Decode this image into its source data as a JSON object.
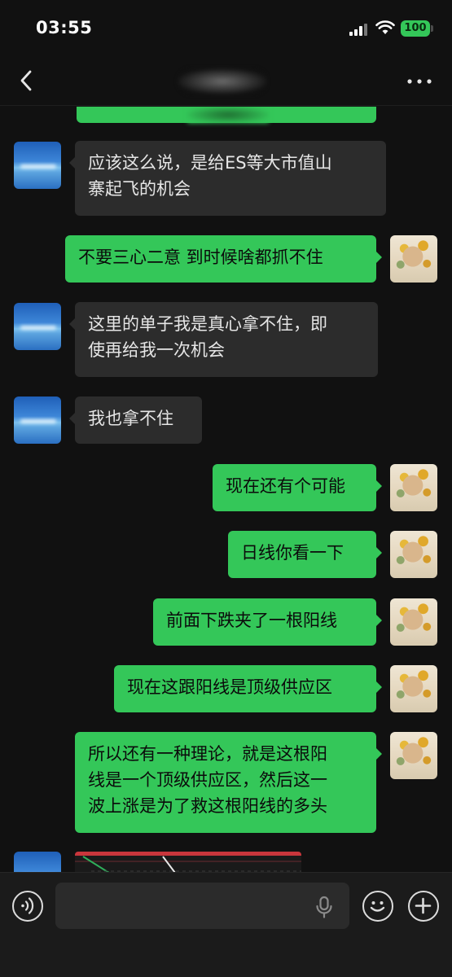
{
  "status_bar": {
    "time": "03:55",
    "battery": "100"
  },
  "nav": {
    "back_icon": "chevron-left-icon",
    "more_icon": "more-dots-icon"
  },
  "messages": [
    {
      "side": "other",
      "text_lines": [
        "应该这么说，是给ES等大市值山",
        "寨起飞的机会"
      ]
    },
    {
      "side": "self",
      "text_lines": [
        "不要三心二意 到时候啥都抓不住"
      ]
    },
    {
      "side": "other",
      "text_lines": [
        "这里的单子我是真心拿不住，即",
        "使再给我一次机会"
      ]
    },
    {
      "side": "other",
      "text_lines": [
        "我也拿不住"
      ]
    },
    {
      "side": "self",
      "text_lines": [
        "现在还有个可能"
      ]
    },
    {
      "side": "self",
      "text_lines": [
        "日线你看一下"
      ]
    },
    {
      "side": "self",
      "text_lines": [
        "前面下跌夹了一根阳线"
      ]
    },
    {
      "side": "self",
      "text_lines": [
        "现在这跟阳线是顶级供应区"
      ]
    },
    {
      "side": "self",
      "text_lines": [
        "所以还有一种理论，就是这根阳",
        "线是一个顶级供应区，然后这一",
        "波上涨是为了救这根阳线的多头"
      ]
    }
  ],
  "input_bar": {
    "placeholder": "",
    "value": ""
  },
  "colors": {
    "self_bubble": "#34c759",
    "other_bubble": "#2c2c2c",
    "background": "#111111"
  }
}
